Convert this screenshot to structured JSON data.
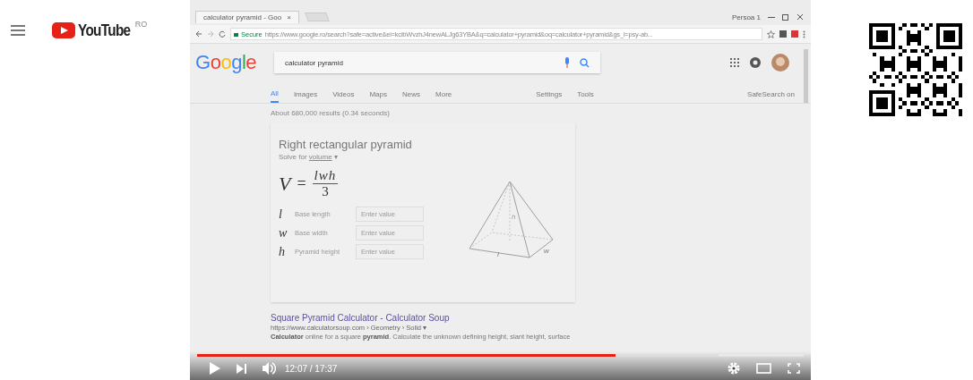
{
  "youtube": {
    "logo": "YouTube",
    "region": "RO"
  },
  "video": {
    "browser": {
      "tab_title": "calculator pyramid - Goo",
      "tab_close": "×",
      "user": "Persoa 1",
      "secure_label": "Secure",
      "url": "https://www.google.ro/search?safe=active&ei=kcibWvzhJ4newALJg63YBA&q=calculator+pyramid&oq=calculator+pyramid&gs_l=psy-ab...",
      "google": {
        "logo": "Google",
        "query": "calculator pyramid",
        "tabs": [
          {
            "label": "All",
            "selected": true
          },
          {
            "label": "Images",
            "selected": false
          },
          {
            "label": "Videos",
            "selected": false
          },
          {
            "label": "Maps",
            "selected": false
          },
          {
            "label": "News",
            "selected": false
          },
          {
            "label": "More",
            "selected": false
          }
        ],
        "tools": [
          "Settings",
          "Tools"
        ],
        "safesearch": "SafeSearch on",
        "results_count": "About 680,000 results (0.34 seconds)",
        "card": {
          "title": "Right rectangular pyramid",
          "solve_for": "Solve for",
          "solve_target": "volume",
          "solve_caret": "▾",
          "formula": {
            "lhs": "V",
            "equals": "=",
            "numerator": "lwh",
            "denominator": "3"
          },
          "fields": [
            {
              "symbol": "l",
              "label": "Base length",
              "placeholder": "Enter value"
            },
            {
              "symbol": "w",
              "label": "Base width",
              "placeholder": "Enter value"
            },
            {
              "symbol": "h",
              "label": "Pyramid height",
              "placeholder": "Enter value"
            }
          ],
          "diagram_labels": {
            "height": "h",
            "length": "l",
            "width": "w"
          }
        },
        "result": {
          "title": "Square Pyramid Calculator - Calculator Soup",
          "url": "https://www.calculatorsoup.com › Geometry › Solid ▾",
          "snippet": "**Calculator** online for a square **pyramid**. Calculate the unknown defining height, slant height, surface"
        }
      }
    },
    "player": {
      "playing": false,
      "progress": {
        "level": 0.69
      },
      "buffered": {
        "level": 0.86
      },
      "time": "12:07 / 17:37"
    }
  }
}
